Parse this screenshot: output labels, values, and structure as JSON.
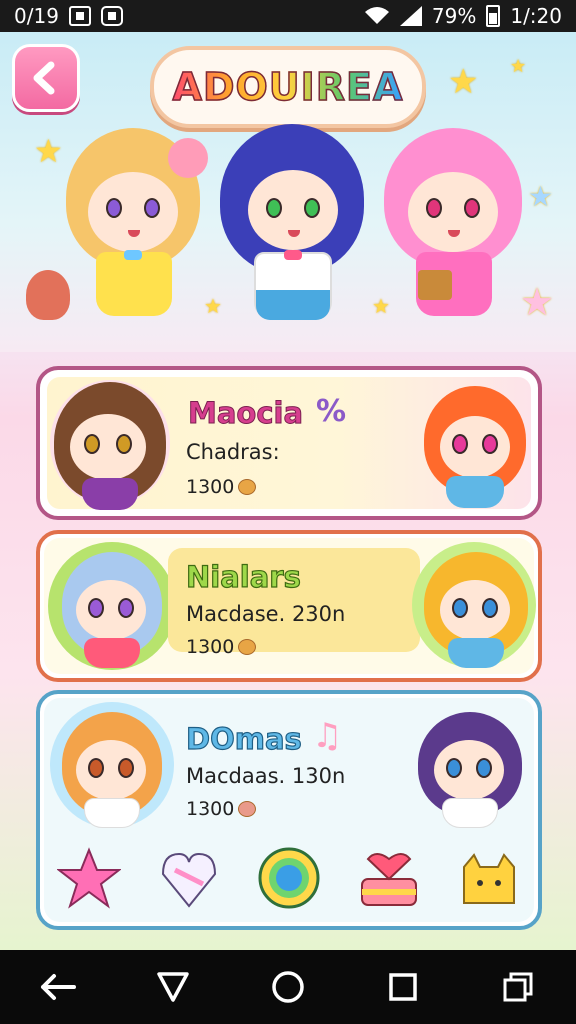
{
  "status_bar": {
    "left_text": "0/19",
    "battery": "79%",
    "time": "1/:20",
    "icons": [
      "gallery-icon",
      "app-icon",
      "wifi-icon",
      "signal-icon",
      "battery-icon"
    ]
  },
  "header": {
    "title": "ADOUIREA",
    "back_icon": "chevron-left-icon"
  },
  "characters": [
    {
      "card": 1,
      "name": "Maocia",
      "extra_icon": "%",
      "detail": "Chadras:",
      "count": "1300"
    },
    {
      "card": 2,
      "name": "Nialars",
      "detail": "Macdase. 230n",
      "count": "1300"
    },
    {
      "card": 3,
      "name": "DOmas",
      "detail": "Macdaas. 130n",
      "count": "1300"
    }
  ],
  "items": [
    "star-item-icon",
    "heart-gem-icon",
    "ring-orb-icon",
    "cake-heart-icon",
    "cat-charm-icon"
  ],
  "nav": [
    "back-nav-icon",
    "home-triangle-icon",
    "home-circle-icon",
    "recent-square-icon",
    "multiwindow-icon"
  ],
  "colors": {
    "accent_pink": "#f36aa2",
    "card1_border": "#b35686",
    "card2_border": "#e1704b",
    "card3_border": "#57a3c8"
  }
}
